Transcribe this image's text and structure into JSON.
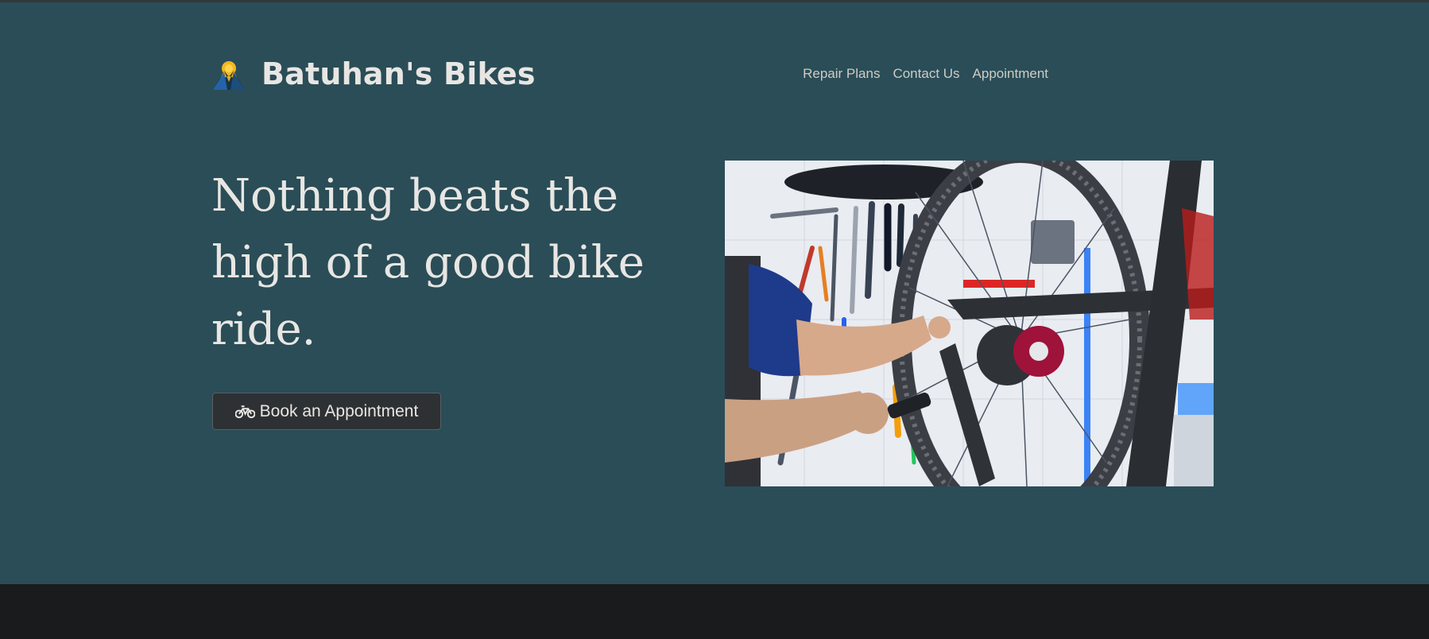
{
  "header": {
    "brand_name": "Batuhan's Bikes",
    "logo_icon": "mountain-sun-logo",
    "nav": [
      {
        "label": "Repair Plans"
      },
      {
        "label": "Contact Us"
      },
      {
        "label": "Appointment"
      }
    ]
  },
  "hero": {
    "headline": "Nothing beats the high of a good bike ride.",
    "cta_label": "Book an Appointment",
    "cta_icon": "bicycle-icon",
    "image_subject": "mechanic-repairing-bicycle-wheel"
  },
  "colors": {
    "hero_bg": "#2a4d57",
    "page_bg": "#191b1c",
    "text": "#e8e6e3",
    "button_bg": "#2e3133",
    "logo_accent": "#f3b81f"
  }
}
